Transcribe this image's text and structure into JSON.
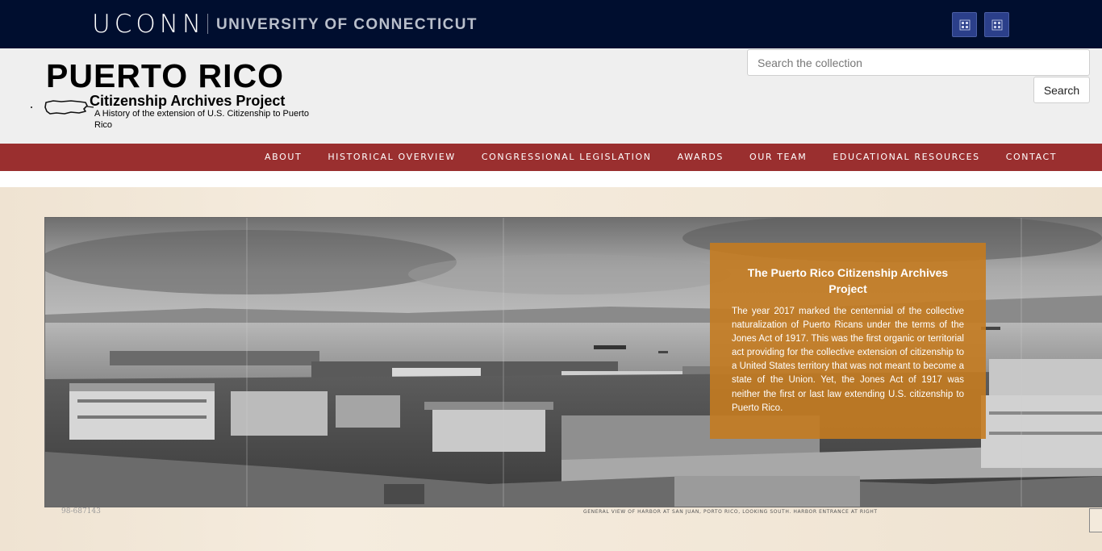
{
  "topbar": {
    "brand_wordmark": "UCONN",
    "university_name": "UNIVERSITY OF CONNECTICUT",
    "util_buttons": [
      "search-icon",
      "apps-icon"
    ],
    "colors": {
      "background": "#000e2f",
      "button": "#2b3f8a"
    }
  },
  "header": {
    "logo": {
      "title": "PUERTO RICO",
      "subtitle": "Citizenship Archives Project",
      "tagline": "A History of the extension of U.S. Citizenship to Puerto Rico"
    },
    "search": {
      "placeholder": "Search the collection",
      "value": "",
      "button_label": "Search"
    }
  },
  "nav": {
    "color": "#9a2f2f",
    "items": [
      {
        "label": "ABOUT"
      },
      {
        "label": "HISTORICAL OVERVIEW"
      },
      {
        "label": "CONGRESSIONAL LEGISLATION"
      },
      {
        "label": "AWARDS"
      },
      {
        "label": "OUR TEAM"
      },
      {
        "label": "EDUCATIONAL RESOURCES"
      },
      {
        "label": "CONTACT"
      }
    ]
  },
  "hero": {
    "photo_caption": "GENERAL VIEW OF HARBOR AT SAN JUAN, PORTO RICO, LOOKING SOUTH.  HARBOR ENTRANCE AT RIGHT",
    "photo_number": "98-687143",
    "overlay": {
      "title": "The Puerto Rico Citizenship Archives Project",
      "body": "The year 2017 marked the centennial of the collective naturalization of Puerto Ricans under the terms of the Jones Act of 1917. This was the first organic or territorial act providing for the collective extension of citizenship to a United States territory that was not meant to become a state of the Union. Yet, the Jones Act of 1917 was neither the first or last law extending U.S. citizenship to Puerto Rico.",
      "color": "#c47b20"
    }
  }
}
